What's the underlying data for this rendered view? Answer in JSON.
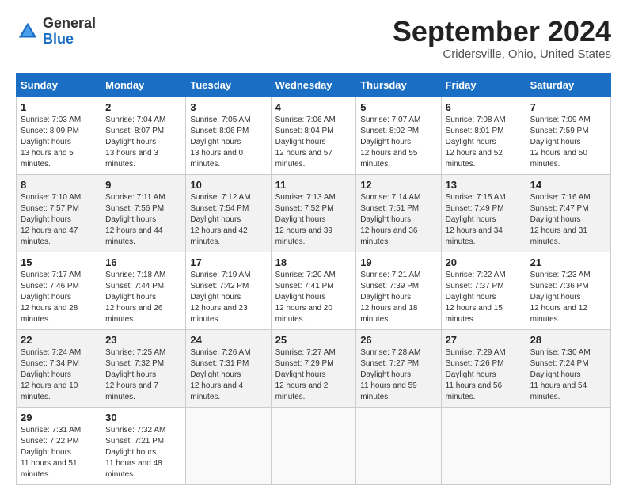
{
  "header": {
    "logo_general": "General",
    "logo_blue": "Blue",
    "month_title": "September 2024",
    "location": "Cridersville, Ohio, United States"
  },
  "days_of_week": [
    "Sunday",
    "Monday",
    "Tuesday",
    "Wednesday",
    "Thursday",
    "Friday",
    "Saturday"
  ],
  "weeks": [
    [
      {
        "day": "1",
        "sunrise": "7:03 AM",
        "sunset": "8:09 PM",
        "daylight": "13 hours and 5 minutes."
      },
      {
        "day": "2",
        "sunrise": "7:04 AM",
        "sunset": "8:07 PM",
        "daylight": "13 hours and 3 minutes."
      },
      {
        "day": "3",
        "sunrise": "7:05 AM",
        "sunset": "8:06 PM",
        "daylight": "13 hours and 0 minutes."
      },
      {
        "day": "4",
        "sunrise": "7:06 AM",
        "sunset": "8:04 PM",
        "daylight": "12 hours and 57 minutes."
      },
      {
        "day": "5",
        "sunrise": "7:07 AM",
        "sunset": "8:02 PM",
        "daylight": "12 hours and 55 minutes."
      },
      {
        "day": "6",
        "sunrise": "7:08 AM",
        "sunset": "8:01 PM",
        "daylight": "12 hours and 52 minutes."
      },
      {
        "day": "7",
        "sunrise": "7:09 AM",
        "sunset": "7:59 PM",
        "daylight": "12 hours and 50 minutes."
      }
    ],
    [
      {
        "day": "8",
        "sunrise": "7:10 AM",
        "sunset": "7:57 PM",
        "daylight": "12 hours and 47 minutes."
      },
      {
        "day": "9",
        "sunrise": "7:11 AM",
        "sunset": "7:56 PM",
        "daylight": "12 hours and 44 minutes."
      },
      {
        "day": "10",
        "sunrise": "7:12 AM",
        "sunset": "7:54 PM",
        "daylight": "12 hours and 42 minutes."
      },
      {
        "day": "11",
        "sunrise": "7:13 AM",
        "sunset": "7:52 PM",
        "daylight": "12 hours and 39 minutes."
      },
      {
        "day": "12",
        "sunrise": "7:14 AM",
        "sunset": "7:51 PM",
        "daylight": "12 hours and 36 minutes."
      },
      {
        "day": "13",
        "sunrise": "7:15 AM",
        "sunset": "7:49 PM",
        "daylight": "12 hours and 34 minutes."
      },
      {
        "day": "14",
        "sunrise": "7:16 AM",
        "sunset": "7:47 PM",
        "daylight": "12 hours and 31 minutes."
      }
    ],
    [
      {
        "day": "15",
        "sunrise": "7:17 AM",
        "sunset": "7:46 PM",
        "daylight": "12 hours and 28 minutes."
      },
      {
        "day": "16",
        "sunrise": "7:18 AM",
        "sunset": "7:44 PM",
        "daylight": "12 hours and 26 minutes."
      },
      {
        "day": "17",
        "sunrise": "7:19 AM",
        "sunset": "7:42 PM",
        "daylight": "12 hours and 23 minutes."
      },
      {
        "day": "18",
        "sunrise": "7:20 AM",
        "sunset": "7:41 PM",
        "daylight": "12 hours and 20 minutes."
      },
      {
        "day": "19",
        "sunrise": "7:21 AM",
        "sunset": "7:39 PM",
        "daylight": "12 hours and 18 minutes."
      },
      {
        "day": "20",
        "sunrise": "7:22 AM",
        "sunset": "7:37 PM",
        "daylight": "12 hours and 15 minutes."
      },
      {
        "day": "21",
        "sunrise": "7:23 AM",
        "sunset": "7:36 PM",
        "daylight": "12 hours and 12 minutes."
      }
    ],
    [
      {
        "day": "22",
        "sunrise": "7:24 AM",
        "sunset": "7:34 PM",
        "daylight": "12 hours and 10 minutes."
      },
      {
        "day": "23",
        "sunrise": "7:25 AM",
        "sunset": "7:32 PM",
        "daylight": "12 hours and 7 minutes."
      },
      {
        "day": "24",
        "sunrise": "7:26 AM",
        "sunset": "7:31 PM",
        "daylight": "12 hours and 4 minutes."
      },
      {
        "day": "25",
        "sunrise": "7:27 AM",
        "sunset": "7:29 PM",
        "daylight": "12 hours and 2 minutes."
      },
      {
        "day": "26",
        "sunrise": "7:28 AM",
        "sunset": "7:27 PM",
        "daylight": "11 hours and 59 minutes."
      },
      {
        "day": "27",
        "sunrise": "7:29 AM",
        "sunset": "7:26 PM",
        "daylight": "11 hours and 56 minutes."
      },
      {
        "day": "28",
        "sunrise": "7:30 AM",
        "sunset": "7:24 PM",
        "daylight": "11 hours and 54 minutes."
      }
    ],
    [
      {
        "day": "29",
        "sunrise": "7:31 AM",
        "sunset": "7:22 PM",
        "daylight": "11 hours and 51 minutes."
      },
      {
        "day": "30",
        "sunrise": "7:32 AM",
        "sunset": "7:21 PM",
        "daylight": "11 hours and 48 minutes."
      },
      null,
      null,
      null,
      null,
      null
    ]
  ],
  "labels": {
    "sunrise": "Sunrise:",
    "sunset": "Sunset:",
    "daylight": "Daylight hours"
  }
}
